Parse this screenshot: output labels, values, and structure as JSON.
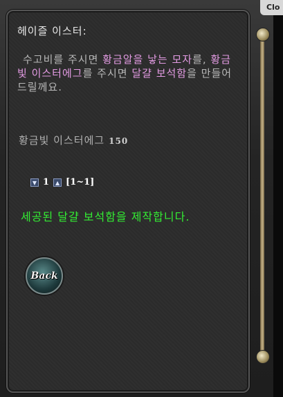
{
  "window": {
    "close_tab": "Clo"
  },
  "npc": {
    "title": "헤이즐 이스터:",
    "dialog": {
      "p1": "수고비를 주시면 ",
      "hl1": "황금알을 낳는 모자",
      "p2": "를, ",
      "hl2": "황금빛 이스터에그",
      "p3": "를 주시면 ",
      "hl3": "달걀 보석함",
      "p4": "을 만들어드릴께요."
    }
  },
  "material": {
    "name": "황금빛 이스터에그",
    "qty": "150"
  },
  "stepper": {
    "down_icon": "▼",
    "value": "1",
    "up_icon": "▲",
    "range": "[1~1]"
  },
  "result_message": "세공된 달걀 보석함을 제작합니다.",
  "back_button": {
    "label": "Back"
  }
}
